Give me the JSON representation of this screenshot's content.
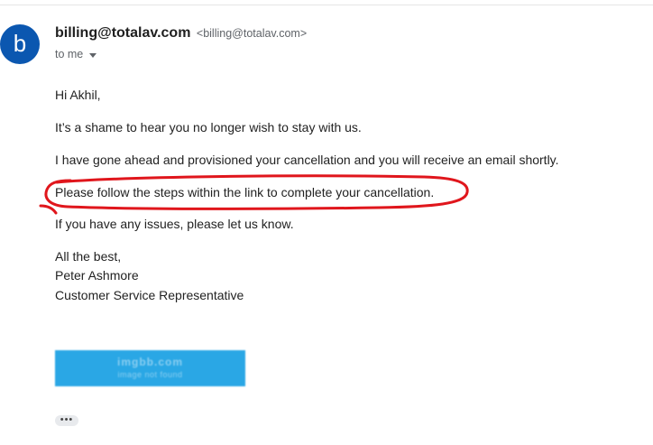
{
  "sender": {
    "avatar_letter": "b",
    "name": "billing@totalav.com",
    "email": "<billing@totalav.com>",
    "to_label": "to me"
  },
  "message": {
    "greeting": "Hi Akhil,",
    "p1": "It’s a shame to hear you no longer wish to stay with us.",
    "p2": "I have gone ahead and provisioned your cancellation and you will receive an email shortly.",
    "p3": "Please follow the steps within the link to complete your cancellation.",
    "p4": "If you have any issues, please let us know.",
    "closing": "All the best,",
    "sig_name": "Peter Ashmore",
    "sig_title": "Customer Service Representative"
  },
  "image_placeholder": {
    "line1": "imgbb.com",
    "line2": "image not found"
  },
  "more_button_label": "•••",
  "colors": {
    "avatar": "#0b57b0",
    "annotation": "#e0161c",
    "placeholder": "#2aa7e5"
  },
  "icons": {
    "caret": "chevron-down-icon"
  }
}
